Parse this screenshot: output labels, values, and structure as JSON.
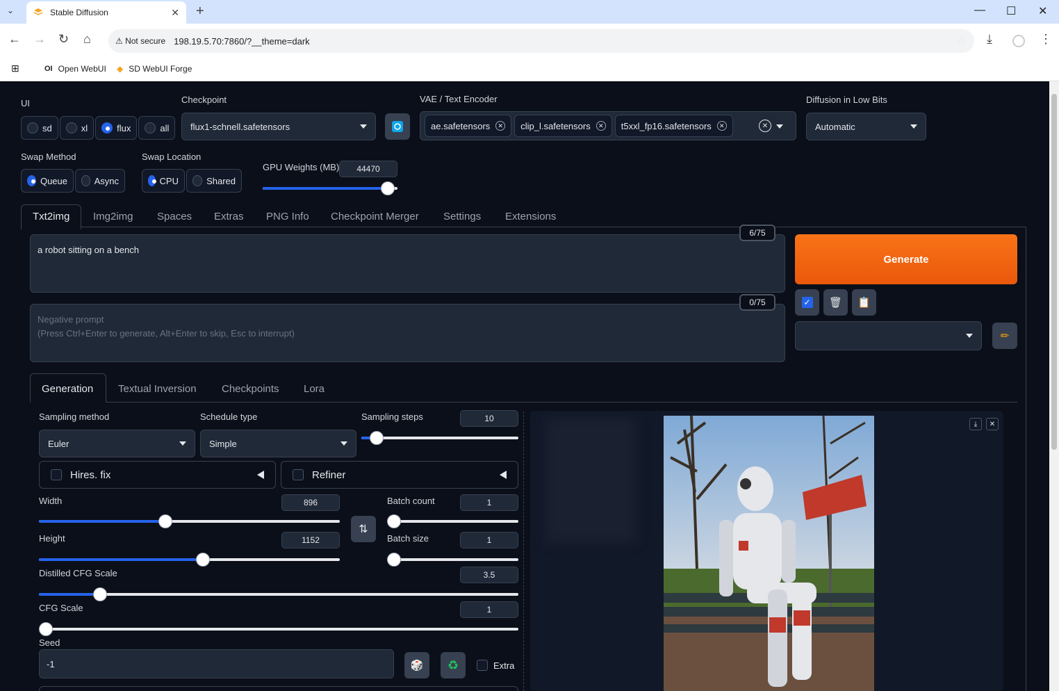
{
  "browser": {
    "tab_title": "Stable Diffusion",
    "security": "Not secure",
    "url": "198.19.5.70:7860/?__theme=dark",
    "bookmarks": [
      "Open WebUI",
      "SD WebUI Forge"
    ]
  },
  "top": {
    "ui_label": "UI",
    "ui_options": [
      "sd",
      "xl",
      "flux",
      "all"
    ],
    "ui_selected": "flux",
    "checkpoint_label": "Checkpoint",
    "checkpoint_value": "flux1-schnell.safetensors",
    "vae_label": "VAE / Text Encoder",
    "vae_chips": [
      "ae.safetensors",
      "clip_l.safetensors",
      "t5xxl_fp16.safetensors"
    ],
    "lowbits_label": "Diffusion in Low Bits",
    "lowbits_value": "Automatic",
    "swap_method_label": "Swap Method",
    "swap_method_options": [
      "Queue",
      "Async"
    ],
    "swap_method_selected": "Queue",
    "swap_location_label": "Swap Location",
    "swap_location_options": [
      "CPU",
      "Shared"
    ],
    "swap_location_selected": "CPU",
    "gpu_weights_label": "GPU Weights (MB)",
    "gpu_weights_value": "44470",
    "gpu_weights_fraction": 0.97
  },
  "main_tabs": [
    "Txt2img",
    "Img2img",
    "Spaces",
    "Extras",
    "PNG Info",
    "Checkpoint Merger",
    "Settings",
    "Extensions"
  ],
  "prompt": {
    "text": "a robot sitting on a bench",
    "counter": "6/75",
    "negative_placeholder_1": "Negative prompt",
    "negative_placeholder_2": "(Press Ctrl+Enter to generate, Alt+Enter to skip, Esc to interrupt)",
    "negative_counter": "0/75"
  },
  "generate_label": "Generate",
  "sub_tabs": [
    "Generation",
    "Textual Inversion",
    "Checkpoints",
    "Lora"
  ],
  "gen": {
    "sampling_method_label": "Sampling method",
    "sampling_method_value": "Euler",
    "schedule_type_label": "Schedule type",
    "schedule_type_value": "Simple",
    "sampling_steps_label": "Sampling steps",
    "sampling_steps_value": "10",
    "hires_label": "Hires. fix",
    "refiner_label": "Refiner",
    "width_label": "Width",
    "width_value": "896",
    "height_label": "Height",
    "height_value": "1152",
    "batch_count_label": "Batch count",
    "batch_count_value": "1",
    "batch_size_label": "Batch size",
    "batch_size_value": "1",
    "distilled_cfg_label": "Distilled CFG Scale",
    "distilled_cfg_value": "3.5",
    "cfg_label": "CFG Scale",
    "cfg_value": "1",
    "seed_label": "Seed",
    "seed_value": "-1",
    "extra_label": "Extra"
  },
  "colors": {
    "accent": "#2563eb",
    "generate": "#ea580c",
    "background": "#0b0f19"
  }
}
